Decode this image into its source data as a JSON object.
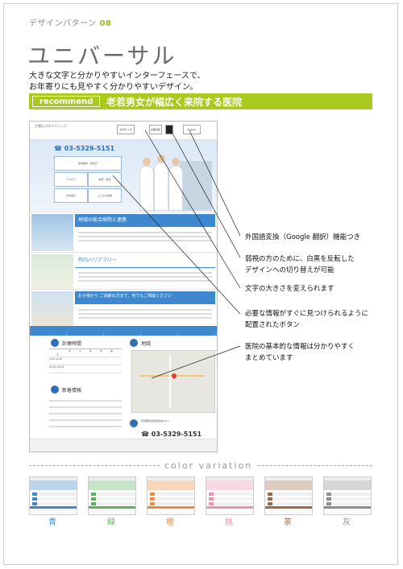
{
  "header": {
    "series_label": "デザインパターン",
    "series_number": "08",
    "title": "ユニバーサル",
    "description_line1": "大きな文字と分かりやすいインターフェースで、",
    "description_line2": "お年寄りにも見やすく分かりやすいデザイン。",
    "recommend_badge": "recommend",
    "recommend_text": "老若男女が幅広く来院する医院"
  },
  "mockup": {
    "logo": "工場ヒロネクリニック",
    "header_buttons": [
      "文字サイズ",
      "白黒反転",
      "English"
    ],
    "tel": "03-5329-5151",
    "hero_boxes": [
      "診療時間・休診日",
      "アクセス",
      "健康・疾患",
      "外来受付",
      "こどもの診療"
    ],
    "sections": [
      {
        "title": "地域の総合病院と連携"
      },
      {
        "title": "院内バリアフリー"
      },
      {
        "title": "お子様から ご高齢の方まで、何でもご相談ください"
      }
    ],
    "nav": [
      "ホーム",
      "医院案内",
      "院長紹介",
      "診療内容・施設案内",
      "アクセス"
    ],
    "hours_title": "診療時間",
    "hours_days": [
      "月",
      "火",
      "水",
      "木",
      "金",
      "土"
    ],
    "hours_rows": [
      "9:00 12:00",
      "16:00 19:00"
    ],
    "news_title": "新着情報",
    "map_title": "地図",
    "address": "東京都新宿区西新宿2-8-1",
    "footer_tel": "03-5329-5151"
  },
  "annotations": [
    {
      "lines": [
        "外国語変換（Google 翻訳）機能つき"
      ]
    },
    {
      "lines": [
        "弱視の方のために、白黒を反転した",
        "デザインへの切り替えが可能"
      ]
    },
    {
      "lines": [
        "文字の大きさを変えられます"
      ]
    },
    {
      "lines": [
        "必要な情報がすぐに見つけられるように",
        "配置されたボタン"
      ]
    },
    {
      "lines": [
        "医院の基本的な情報は分かりやすく",
        "まとめています"
      ]
    }
  ],
  "color_variation": {
    "heading": "color variation",
    "items": [
      {
        "label": "青",
        "color": "#3e88cf"
      },
      {
        "label": "緑",
        "color": "#5bb15f"
      },
      {
        "label": "橙",
        "color": "#ef8a3a"
      },
      {
        "label": "桃",
        "color": "#ec8fb0"
      },
      {
        "label": "茶",
        "color": "#9c6a44"
      },
      {
        "label": "灰",
        "color": "#8c8c8c"
      }
    ]
  },
  "colors": {
    "accent_green": "#a9c91e",
    "site_blue": "#3e88cf"
  }
}
